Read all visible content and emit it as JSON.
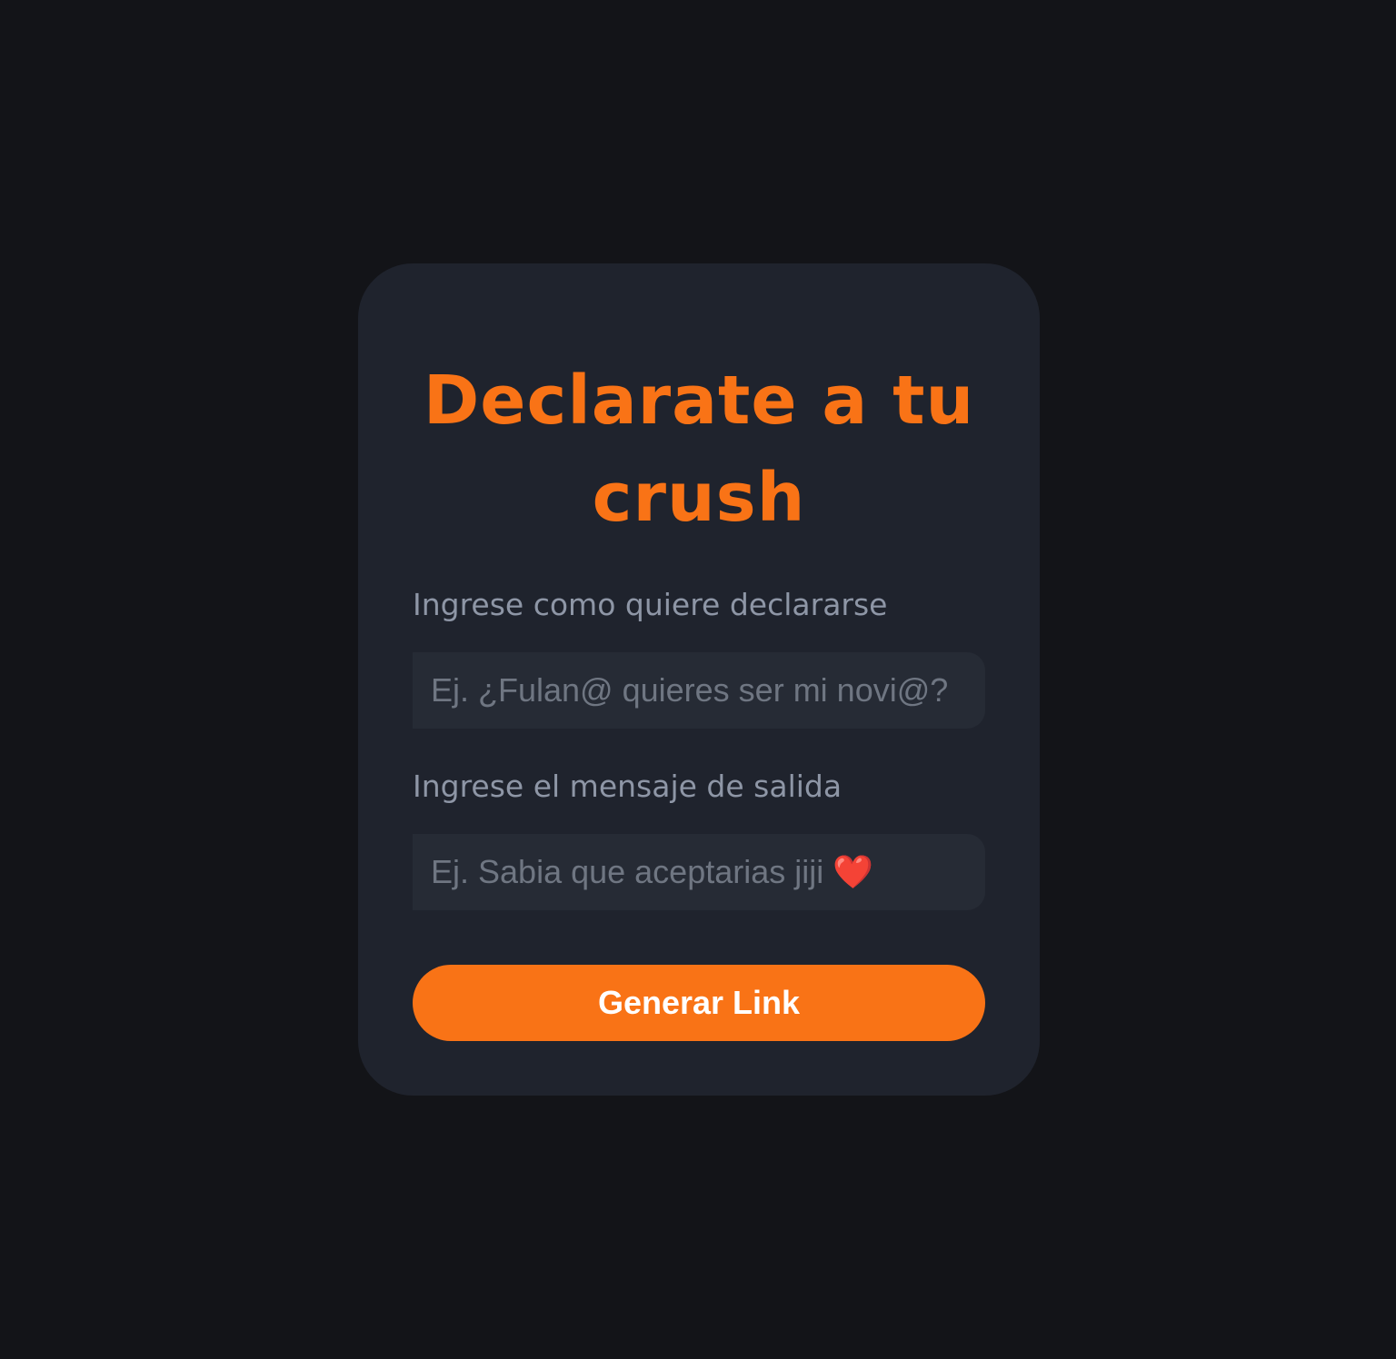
{
  "form": {
    "title": "Declarate a tu crush",
    "declaration_label": "Ingrese como quiere declararse",
    "declaration_placeholder": "Ej. ¿Fulan@ quieres ser mi novi@?",
    "exit_label": "Ingrese el mensaje de salida",
    "exit_placeholder": "Ej. Sabia que aceptarias jiji ❤️",
    "submit_label": "Generar Link"
  },
  "colors": {
    "accent": "#f97316",
    "background": "#131418",
    "card": "#1f232d",
    "input": "#262b35"
  }
}
